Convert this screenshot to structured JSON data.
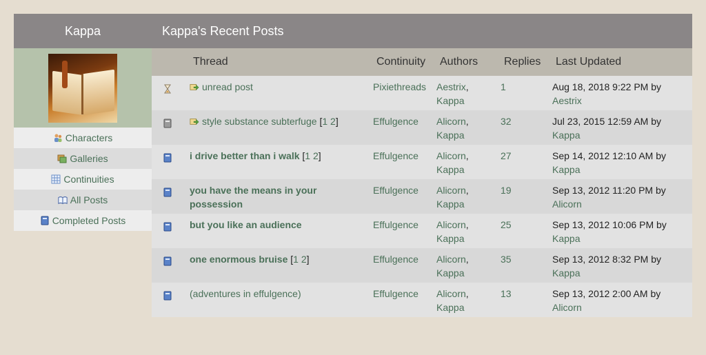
{
  "sidebar": {
    "title": "Kappa",
    "items": [
      {
        "label": "Characters",
        "icon": "characters-icon"
      },
      {
        "label": "Galleries",
        "icon": "galleries-icon"
      },
      {
        "label": "Continuities",
        "icon": "continuities-icon"
      },
      {
        "label": "All Posts",
        "icon": "book-open-icon"
      },
      {
        "label": "Completed Posts",
        "icon": "book-closed-icon"
      }
    ]
  },
  "main": {
    "title": "Kappa's Recent Posts",
    "columns": {
      "thread": "Thread",
      "continuity": "Continuity",
      "authors": "Authors",
      "replies": "Replies",
      "updated": "Last Updated"
    },
    "rows": [
      {
        "status": "hourglass-icon",
        "unread": true,
        "thread": "unread post",
        "pages": [],
        "bold": false,
        "continuity": "Pixiethreads",
        "author1": "Aestrix",
        "author2": "Kappa",
        "replies": "1",
        "date": "Aug 18, 2018 9:22 PM by",
        "by": "Aestrix"
      },
      {
        "status": "book-gray-icon",
        "unread": true,
        "thread": "style substance subterfuge",
        "pages": [
          "1",
          "2"
        ],
        "bold": false,
        "continuity": "Effulgence",
        "author1": "Alicorn",
        "author2": "Kappa",
        "replies": "32",
        "date": "Jul 23, 2015 12:59 AM by",
        "by": "Kappa"
      },
      {
        "status": "book-blue-icon",
        "unread": false,
        "thread": "i drive better than i walk",
        "pages": [
          "1",
          "2"
        ],
        "bold": true,
        "continuity": "Effulgence",
        "author1": "Alicorn",
        "author2": "Kappa",
        "replies": "27",
        "date": "Sep 14, 2012 12:10 AM by",
        "by": "Kappa"
      },
      {
        "status": "book-blue-icon",
        "unread": false,
        "thread": "you have the means in your possession",
        "pages": [],
        "bold": true,
        "continuity": "Effulgence",
        "author1": "Alicorn",
        "author2": "Kappa",
        "replies": "19",
        "date": "Sep 13, 2012 11:20 PM by",
        "by": "Alicorn"
      },
      {
        "status": "book-blue-icon",
        "unread": false,
        "thread": "but you like an audience",
        "pages": [],
        "bold": true,
        "continuity": "Effulgence",
        "author1": "Alicorn",
        "author2": "Kappa",
        "replies": "25",
        "date": "Sep 13, 2012 10:06 PM by",
        "by": "Kappa"
      },
      {
        "status": "book-blue-icon",
        "unread": false,
        "thread": "one enormous bruise",
        "pages": [
          "1",
          "2"
        ],
        "bold": true,
        "continuity": "Effulgence",
        "author1": "Alicorn",
        "author2": "Kappa",
        "replies": "35",
        "date": "Sep 13, 2012 8:32 PM by",
        "by": "Kappa"
      },
      {
        "status": "book-blue-icon",
        "unread": false,
        "thread": "(adventures in effulgence)",
        "pages": [],
        "bold": false,
        "continuity": "Effulgence",
        "author1": "Alicorn",
        "author2": "Kappa",
        "replies": "13",
        "date": "Sep 13, 2012 2:00 AM by",
        "by": "Alicorn"
      }
    ]
  },
  "colors": {
    "header": "#8a8687",
    "colhead": "#bcb8ae",
    "link": "#4a7058",
    "bg": "#e5ddd0",
    "avatarbg": "#b5c2ab"
  }
}
